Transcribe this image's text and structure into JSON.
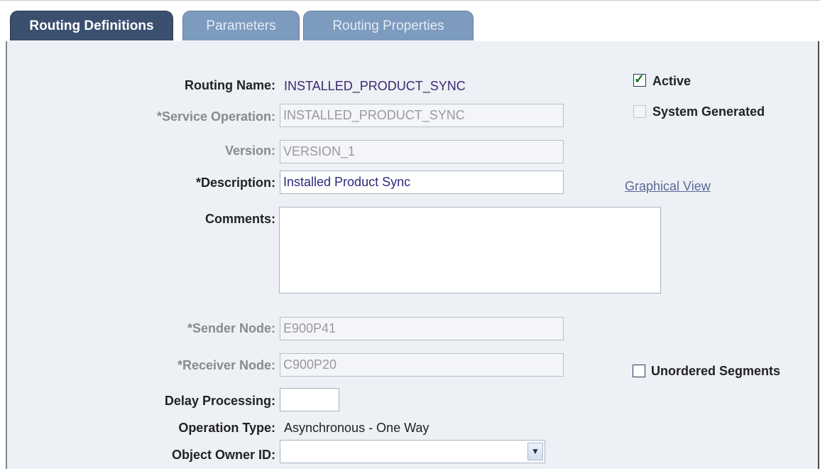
{
  "tabs": [
    {
      "label": "Routing Definitions",
      "active": true
    },
    {
      "label": "Parameters",
      "active": false
    },
    {
      "label": "Routing Properties",
      "active": false
    }
  ],
  "form": {
    "routing_name": {
      "label": "Routing Name:",
      "value": "INSTALLED_PRODUCT_SYNC"
    },
    "service_operation": {
      "label": "*Service Operation:",
      "value": "INSTALLED_PRODUCT_SYNC"
    },
    "version": {
      "label": "Version:",
      "value": "VERSION_1"
    },
    "description": {
      "label": "*Description:",
      "value": "Installed Product Sync"
    },
    "comments": {
      "label": "Comments:",
      "value": ""
    },
    "sender_node": {
      "label": "*Sender Node:",
      "value": "E900P41"
    },
    "receiver_node": {
      "label": "*Receiver Node:",
      "value": "C900P20"
    },
    "delay_processing": {
      "label": "Delay Processing:",
      "value": ""
    },
    "operation_type": {
      "label": "Operation Type:",
      "value": "Asynchronous - One Way"
    },
    "object_owner_id": {
      "label": "Object Owner ID:",
      "value": ""
    }
  },
  "checkboxes": {
    "active": {
      "label": "Active",
      "checked": true
    },
    "system_generated": {
      "label": "System Generated",
      "checked": false
    },
    "unordered_segments": {
      "label": "Unordered Segments",
      "checked": false
    }
  },
  "links": {
    "graphical_view": "Graphical View"
  },
  "icons": {
    "checkmark": "✓",
    "dropdown": "chevron-down-icon"
  }
}
